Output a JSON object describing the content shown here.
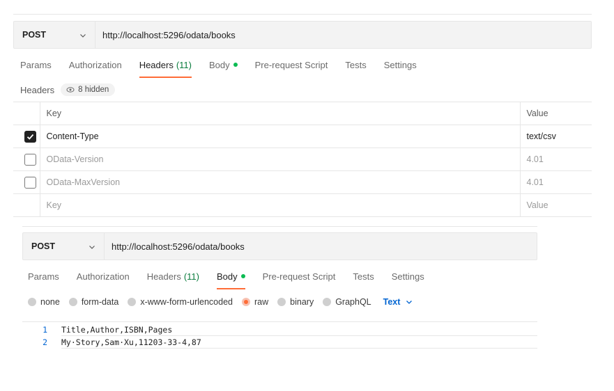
{
  "request1": {
    "method": "POST",
    "url": "http://localhost:5296/odata/books",
    "tabs": [
      {
        "label": "Params"
      },
      {
        "label": "Authorization"
      },
      {
        "label": "Headers",
        "count": "(11)"
      },
      {
        "label": "Body"
      },
      {
        "label": "Pre-request Script"
      },
      {
        "label": "Tests"
      },
      {
        "label": "Settings"
      }
    ],
    "active_tab": "Headers",
    "headers_label": "Headers",
    "hidden_label": "8 hidden",
    "table": {
      "col_key": "Key",
      "col_value": "Value",
      "rows": [
        {
          "key": "Content-Type",
          "value": "text/csv",
          "checked": true
        },
        {
          "key": "OData-Version",
          "value": "4.01",
          "checked": false
        },
        {
          "key": "OData-MaxVersion",
          "value": "4.01",
          "checked": false
        }
      ],
      "placeholder_key": "Key",
      "placeholder_value": "Value"
    }
  },
  "request2": {
    "method": "POST",
    "url": "http://localhost:5296/odata/books",
    "tabs": [
      {
        "label": "Params"
      },
      {
        "label": "Authorization"
      },
      {
        "label": "Headers",
        "count": "(11)"
      },
      {
        "label": "Body"
      },
      {
        "label": "Pre-request Script"
      },
      {
        "label": "Tests"
      },
      {
        "label": "Settings"
      }
    ],
    "active_tab": "Body",
    "body_options": [
      "none",
      "form-data",
      "x-www-form-urlencoded",
      "raw",
      "binary",
      "GraphQL"
    ],
    "selected_option": "raw",
    "format": "Text",
    "editor_lines": [
      {
        "n": "1",
        "text": "Title,Author,ISBN,Pages"
      },
      {
        "n": "2",
        "text": "My·Story,Sam·Xu,11203-33-4,87"
      }
    ]
  },
  "colors": {
    "accent": "#ff6c37",
    "link": "#0265d2",
    "count_green": "#0b7c3e",
    "dot_green": "#0cbb52"
  }
}
